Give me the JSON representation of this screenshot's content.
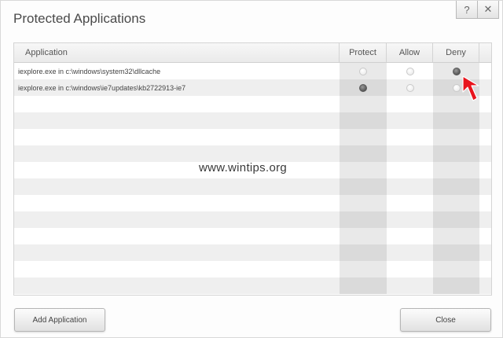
{
  "dialog": {
    "title": "Protected Applications",
    "help_label": "?",
    "close_label": "✕"
  },
  "table": {
    "columns": {
      "application": "Application",
      "protect": "Protect",
      "allow": "Allow",
      "deny": "Deny"
    },
    "rows": [
      {
        "application": "iexplore.exe in c:\\windows\\system32\\dllcache",
        "selected": "deny"
      },
      {
        "application": "iexplore.exe in c:\\windows\\ie7updates\\kb2722913-ie7",
        "selected": "protect"
      },
      {
        "application": "",
        "selected": ""
      },
      {
        "application": "",
        "selected": ""
      },
      {
        "application": "",
        "selected": ""
      },
      {
        "application": "",
        "selected": ""
      },
      {
        "application": "",
        "selected": ""
      },
      {
        "application": "",
        "selected": ""
      },
      {
        "application": "",
        "selected": ""
      },
      {
        "application": "",
        "selected": ""
      },
      {
        "application": "",
        "selected": ""
      },
      {
        "application": "",
        "selected": ""
      },
      {
        "application": "",
        "selected": ""
      },
      {
        "application": "",
        "selected": ""
      }
    ]
  },
  "watermark": "www.wintips.org",
  "buttons": {
    "add_application": "Add Application",
    "close": "Close"
  },
  "colors": {
    "arrow": "#e8141c"
  }
}
